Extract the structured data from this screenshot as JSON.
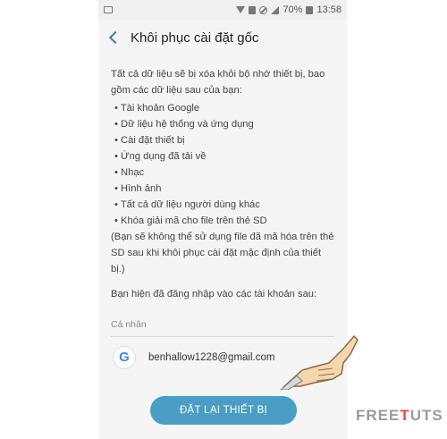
{
  "status_bar": {
    "battery": "70%",
    "time": "13:58"
  },
  "header": {
    "title": "Khôi phục cài đặt gốc"
  },
  "content": {
    "intro": "Tất cả dữ liệu sẽ bị xóa khỏi bộ nhớ thiết bị, bao gồm các dữ liệu sau của bạn:",
    "items": [
      "Tài khoản Google",
      "Dữ liệu hệ thống và ứng dụng",
      "Cài đặt thiết bị",
      "Ứng dụng đã tải về",
      "Nhạc",
      "Hình ảnh",
      "Tất cả dữ liệu người dùng khác",
      "Khóa giải mã cho file trên thẻ SD"
    ],
    "note": "(Bạn sẽ không thể sử dụng file đã mã hóa trên thẻ SD sau khi khôi phục cài đặt mặc định của thiết bị.)",
    "signed_in": "Bạn hiện đã đăng nhập vào các tài khoản sau:"
  },
  "accounts": {
    "section_label": "Cá nhân",
    "google_letter": "G",
    "email": "benhallow1228@gmail.com"
  },
  "reset_button": {
    "label": "ĐẶT LẠI THIẾT BỊ"
  },
  "watermark": {
    "part1": "FREE",
    "part2": "T",
    "part3": "UTS"
  },
  "colors": {
    "accent": "#4a9dc4",
    "back_arrow": "#3e7da8",
    "watermark_accent": "#e94b3c"
  }
}
